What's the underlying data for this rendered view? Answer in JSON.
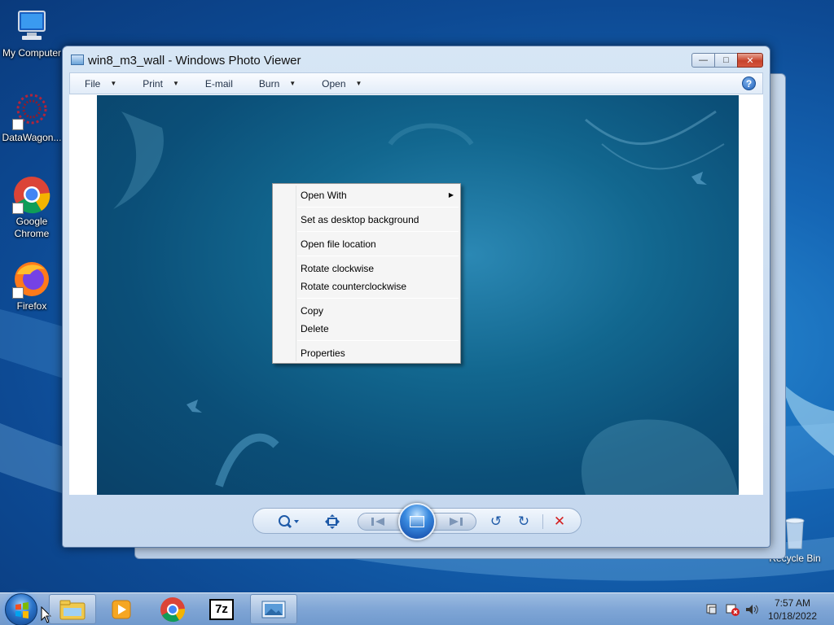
{
  "desktop": {
    "icons": [
      {
        "label": "My Computer"
      },
      {
        "label": "DataWagon..."
      },
      {
        "label": "Google Chrome"
      },
      {
        "label": "Firefox"
      }
    ],
    "recycle_bin_label": "Recycle Bin"
  },
  "window": {
    "title": "win8_m3_wall - Windows Photo Viewer",
    "menu": {
      "file": "File",
      "print": "Print",
      "email": "E-mail",
      "burn": "Burn",
      "open": "Open"
    },
    "help": "?"
  },
  "context_menu": {
    "items": [
      {
        "label": "Open With",
        "submenu": true
      },
      {
        "label": "Set as desktop background"
      },
      {
        "label": "Open file location"
      },
      {
        "label": "Rotate clockwise"
      },
      {
        "label": "Rotate counterclockwise"
      },
      {
        "label": "Copy"
      },
      {
        "label": "Delete"
      },
      {
        "label": "Properties"
      }
    ]
  },
  "taskbar": {
    "apps": [
      "windows-explorer",
      "media-player",
      "google-chrome",
      "7-zip",
      "windows-photo-viewer"
    ],
    "sevenzip_label": "7z",
    "clock": {
      "time": "7:57 AM",
      "date": "10/18/2022"
    }
  },
  "colors": {
    "accent": "#1e5aa8",
    "close_button": "#c7432b",
    "delete_x": "#d42020"
  }
}
